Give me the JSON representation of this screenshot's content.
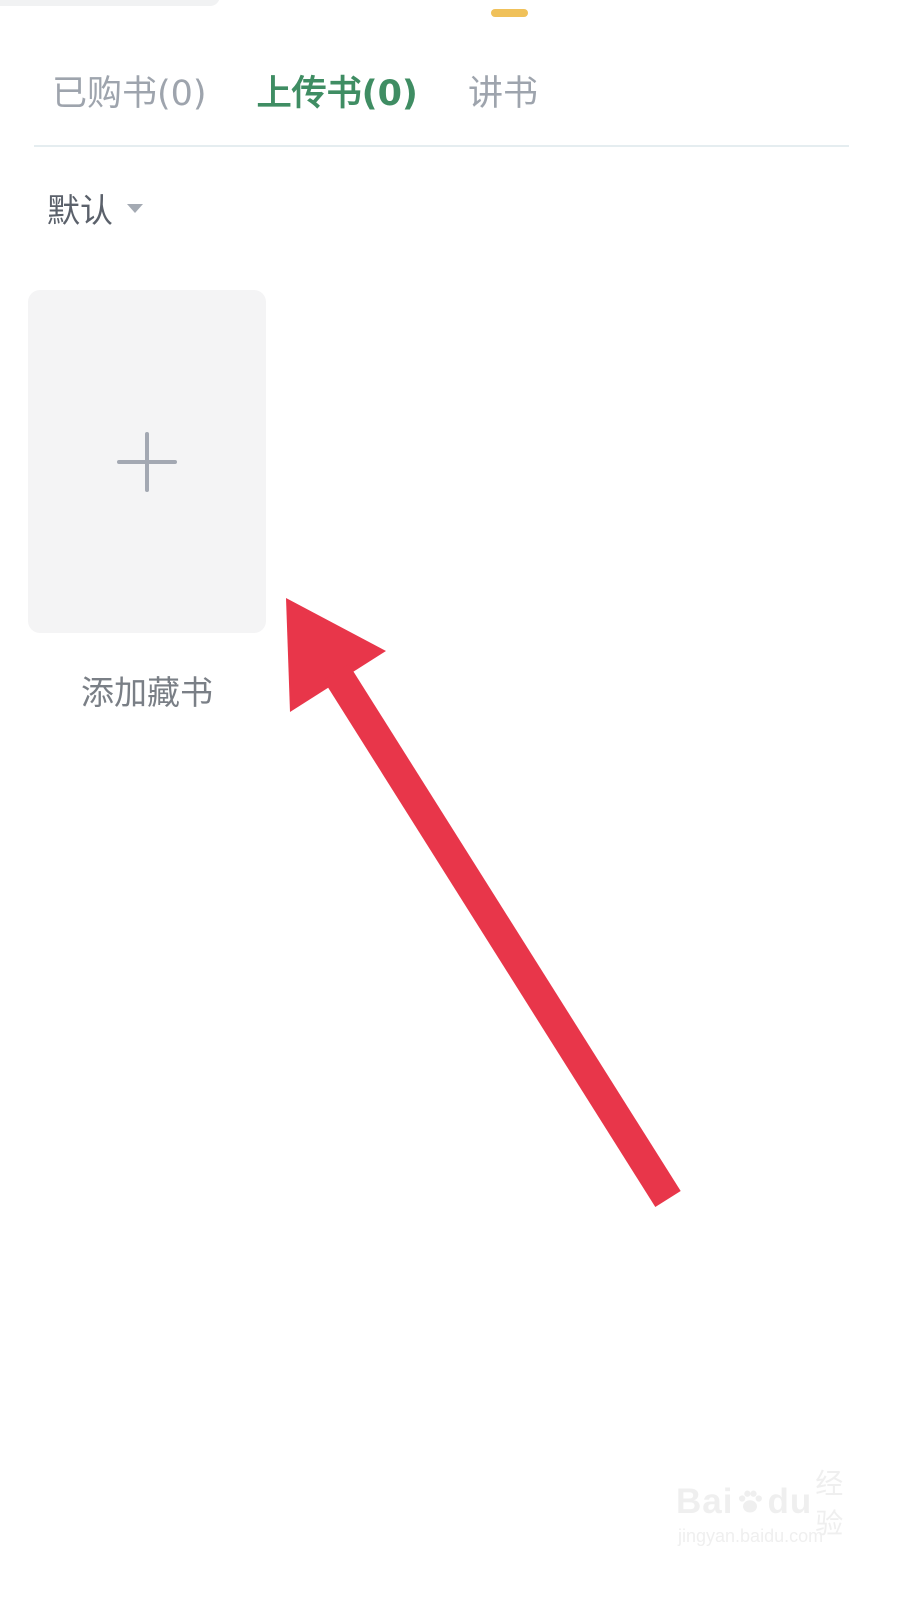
{
  "tabs": [
    {
      "label": "已购书(0)",
      "active": false
    },
    {
      "label": "上传书(0)",
      "active": true
    },
    {
      "label": "讲书",
      "active": false
    }
  ],
  "sort": {
    "selected": "默认"
  },
  "add_card": {
    "label": "添加藏书",
    "icon": "plus-icon"
  },
  "annotation": {
    "type": "arrow",
    "color": "#e8364a"
  },
  "watermark": {
    "logo_left": "Bai",
    "logo_right": "du",
    "brand": "经验",
    "url": "jingyan.baidu.com"
  },
  "colors": {
    "accent": "#3f8d63",
    "indicator": "#f0c15a",
    "tab_inactive": "#9ea4ad",
    "card_bg": "#f4f4f5"
  }
}
